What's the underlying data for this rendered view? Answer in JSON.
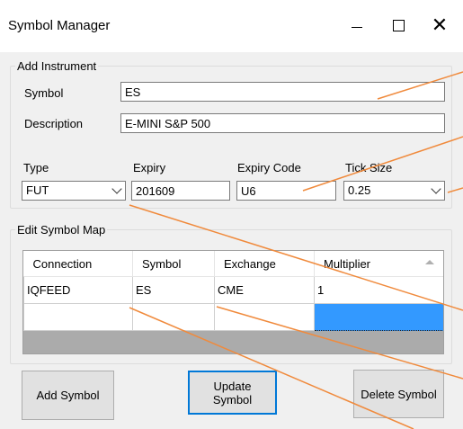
{
  "window": {
    "title": "Symbol Manager",
    "controls": {
      "minimize": "minimize-icon",
      "maximize": "maximize-icon",
      "close": "✕"
    }
  },
  "add_instrument": {
    "legend": "Add Instrument",
    "symbol_label": "Symbol",
    "symbol_value": "ES",
    "description_label": "Description",
    "description_value": "E-MINI S&P 500",
    "type_label": "Type",
    "type_value": "FUT",
    "expiry_label": "Expiry",
    "expiry_value": "201609",
    "expiry_code_label": "Expiry Code",
    "expiry_code_value": "U6",
    "tick_size_label": "Tick Size",
    "tick_size_value": "0.25"
  },
  "symbol_map": {
    "legend": "Edit Symbol Map",
    "columns": [
      "Connection",
      "Symbol",
      "Exchange",
      "Multiplier"
    ],
    "rows": [
      [
        "IQFEED",
        "ES",
        "CME",
        "1"
      ],
      [
        "",
        "",
        "",
        ""
      ]
    ]
  },
  "buttons": {
    "add": "Add Symbol",
    "update": "Update Symbol",
    "delete": "Delete Symbol"
  },
  "colors": {
    "annotation_line": "#f08a3c",
    "selection": "#3399ff",
    "focus_border": "#0078d7"
  }
}
